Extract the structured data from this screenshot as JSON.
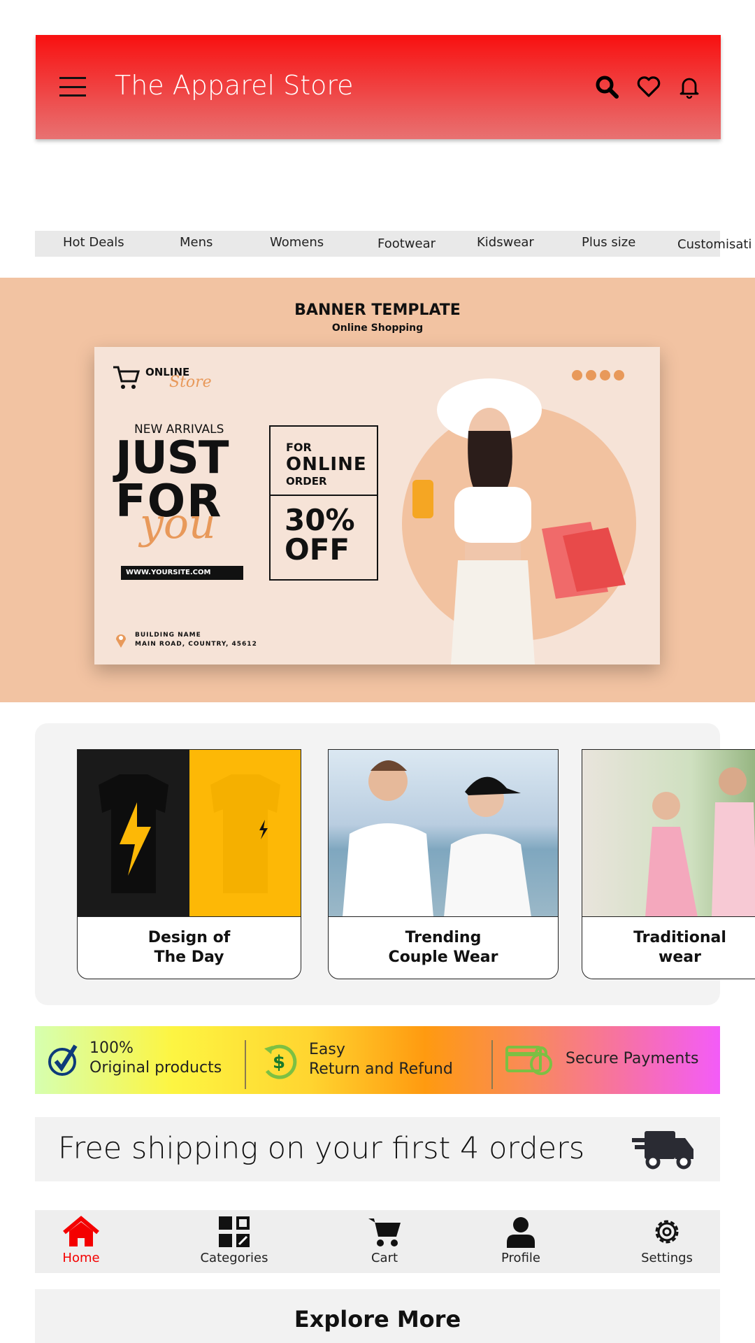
{
  "header": {
    "title": "The Apparel Store",
    "icons": [
      "menu-icon",
      "search-icon",
      "heart-icon",
      "bell-icon"
    ],
    "accent": "#f81010"
  },
  "tabs": [
    "Hot Deals",
    "Mens",
    "Womens",
    "Footwear",
    "Kidswear",
    "Plus size",
    "Customisati"
  ],
  "banner": {
    "title": "BANNER TEMPLATE",
    "subtitle": "Online Shopping",
    "logo_top": "ONLINE",
    "logo_script": "Store",
    "new_arrivals": "NEW ARRIVALS",
    "just": "JUST",
    "for": "FOR",
    "you": "you",
    "site": "WWW.YOURSITE.COM",
    "offer_for": "FOR",
    "offer_online": "ONLINE",
    "offer_order": "ORDER",
    "offer_pct": "30%",
    "offer_off": "OFF",
    "address1": "BUILDING NAME",
    "address2": "MAIN ROAD, COUNTRY, 45612"
  },
  "categories": [
    {
      "line1": "Design of",
      "line2": "The Day"
    },
    {
      "line1": "Trending",
      "line2": "Couple Wear"
    },
    {
      "line1": "Traditional",
      "line2": "wear"
    }
  ],
  "features": [
    {
      "line1": "100%",
      "line2": "Original products",
      "icon": "check-circle-icon"
    },
    {
      "line1": "Easy",
      "line2": "Return and Refund",
      "icon": "refund-dollar-icon"
    },
    {
      "line1": "Secure Payments",
      "icon": "card-lock-icon"
    }
  ],
  "shipping": {
    "text": "Free shipping on your first 4 orders",
    "icon": "truck-icon"
  },
  "nav": [
    {
      "label": "Home",
      "icon": "home-icon",
      "active": true,
      "color": "#f40000"
    },
    {
      "label": "Categories",
      "icon": "grid-icon"
    },
    {
      "label": "Cart",
      "icon": "cart-icon"
    },
    {
      "label": "Profile",
      "icon": "user-icon"
    },
    {
      "label": "Settings",
      "icon": "gear-icon"
    }
  ],
  "explore": "Explore More"
}
